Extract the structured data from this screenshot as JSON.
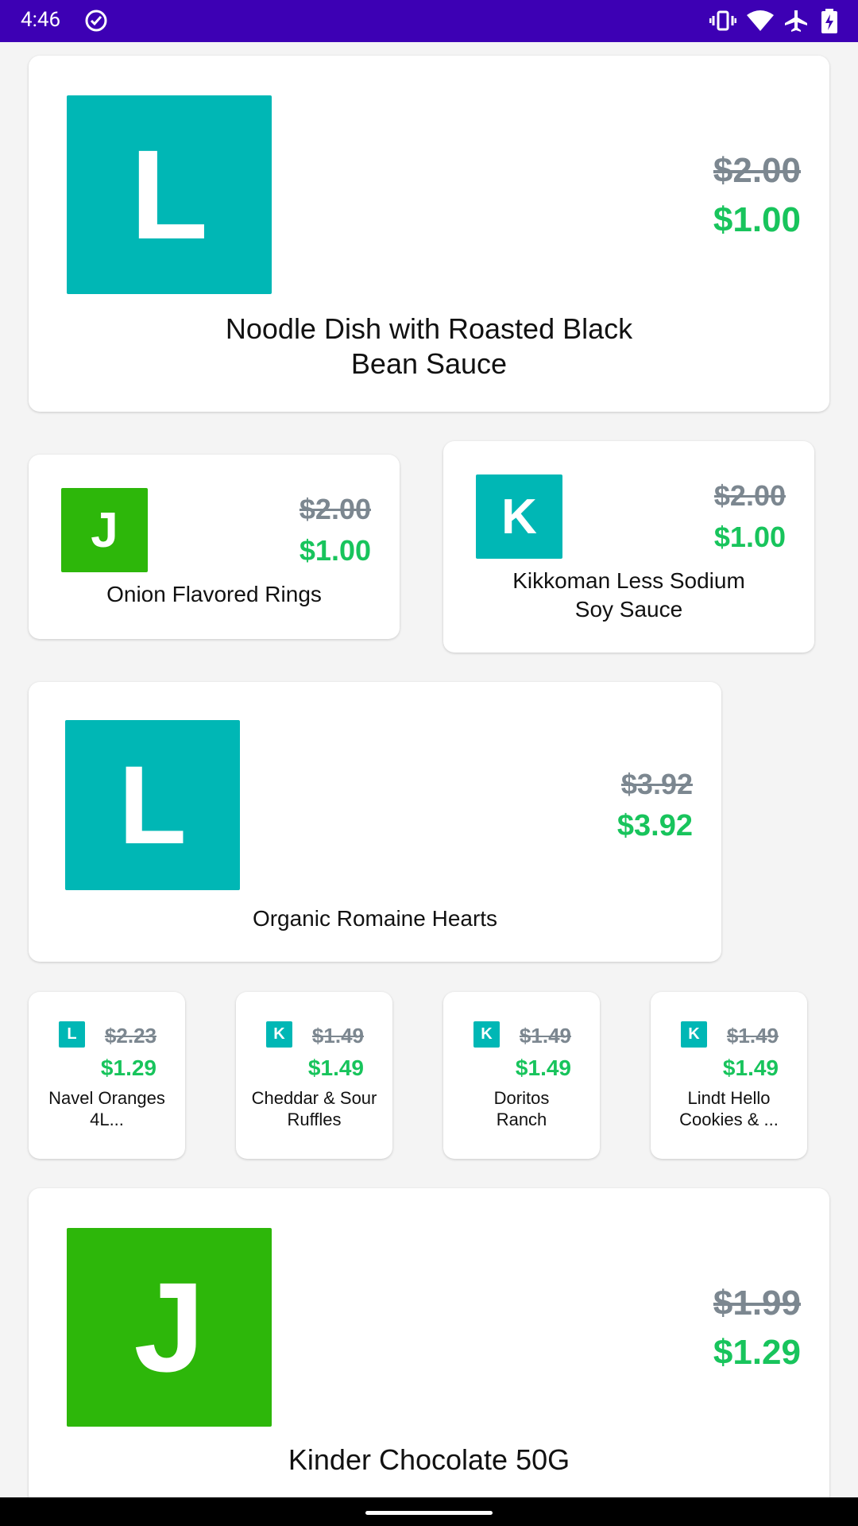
{
  "status_bar": {
    "time": "4:46",
    "icons": [
      "check-circle-icon",
      "vibrate-icon",
      "wifi-icon",
      "airplane-icon",
      "battery-charging-icon"
    ]
  },
  "products": [
    {
      "letter": "L",
      "tile_color": "#00b7b5",
      "old_price": "$2.00",
      "new_price": "$1.00",
      "name": "Noodle Dish with Roasted Black Bean Sauce"
    },
    {
      "letter": "J",
      "tile_color": "#2db70a",
      "old_price": "$2.00",
      "new_price": "$1.00",
      "name": "Onion Flavored Rings"
    },
    {
      "letter": "K",
      "tile_color": "#00b7b5",
      "old_price": "$2.00",
      "new_price": "$1.00",
      "name": "Kikkoman Less Sodium Soy Sauce"
    },
    {
      "letter": "L",
      "tile_color": "#00b7b5",
      "old_price": "$3.92",
      "new_price": "$3.92",
      "name": "Organic Romaine Hearts"
    },
    {
      "letter": "L",
      "tile_color": "#00b7b5",
      "old_price": "$2.23",
      "new_price": "$1.29",
      "name": "Navel Oranges 4L..."
    },
    {
      "letter": "K",
      "tile_color": "#00b7b5",
      "old_price": "$1.49",
      "new_price": "$1.49",
      "name": "Cheddar & Sour Ruffles"
    },
    {
      "letter": "K",
      "tile_color": "#00b7b5",
      "old_price": "$1.49",
      "new_price": "$1.49",
      "name": "Doritos Ranch"
    },
    {
      "letter": "K",
      "tile_color": "#00b7b5",
      "old_price": "$1.49",
      "new_price": "$1.49",
      "name": "Lindt Hello Cookies & ..."
    },
    {
      "letter": "J",
      "tile_color": "#2db70a",
      "old_price": "$1.99",
      "new_price": "$1.29",
      "name": "Kinder Chocolate 50G"
    }
  ],
  "colors": {
    "status_bar": "#3d00b4",
    "old_price": "#7c8790",
    "new_price": "#18c45c",
    "teal": "#00b7b5",
    "green": "#2db70a"
  }
}
